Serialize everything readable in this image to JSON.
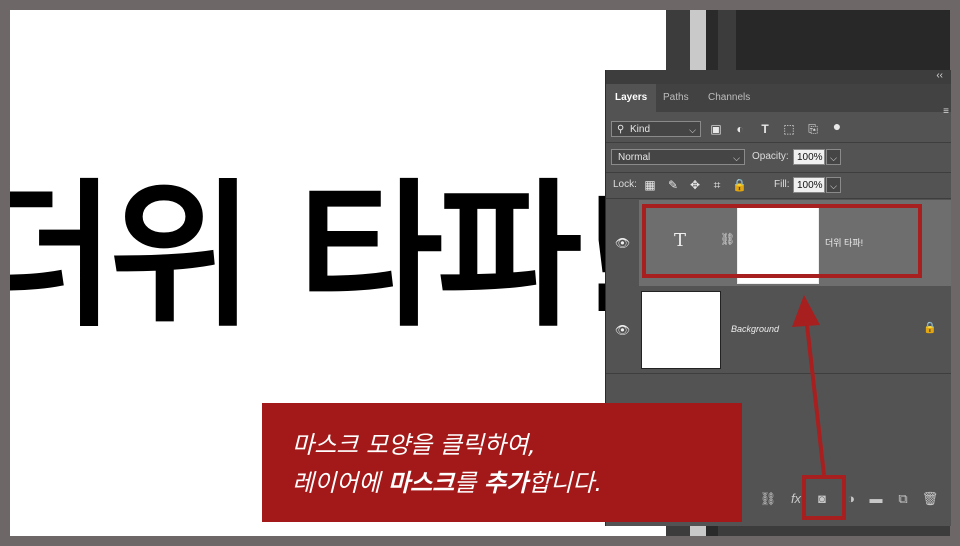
{
  "canvas": {
    "headline": "더위 타파!"
  },
  "panel": {
    "collapse_glyph": "‹‹",
    "menu_glyph": "≡",
    "tabs": [
      {
        "label": "Layers",
        "active": true
      },
      {
        "label": "Paths",
        "active": false
      },
      {
        "label": "Channels",
        "active": false
      }
    ],
    "filter": {
      "kind_label": "Kind"
    },
    "blend": {
      "mode": "Normal",
      "opacity_label": "Opacity:",
      "opacity_value": "100%"
    },
    "lock": {
      "label": "Lock:",
      "fill_label": "Fill:",
      "fill_value": "100%"
    },
    "layers": [
      {
        "name": "더위 타파!",
        "type": "text",
        "visible": true,
        "selected": true,
        "thumb_glyph": "T",
        "link_glyph": "⛓"
      },
      {
        "name": "Background",
        "type": "image",
        "visible": true,
        "selected": false,
        "locked": true
      }
    ]
  },
  "caption": {
    "line1": "마스크 모양을 클릭하여,",
    "line2_pre": "레이어에 ",
    "line2_bold1": "마스크",
    "line2_mid": "를 ",
    "line2_bold2": "추가",
    "line2_post": "합니다."
  },
  "bottom_bar": {
    "fx_label": "fx"
  },
  "colors": {
    "highlight": "#a81f1f",
    "caption_bg": "#a31818",
    "panel_bg": "#535353",
    "selected_layer_bg": "#6e6e6e"
  }
}
